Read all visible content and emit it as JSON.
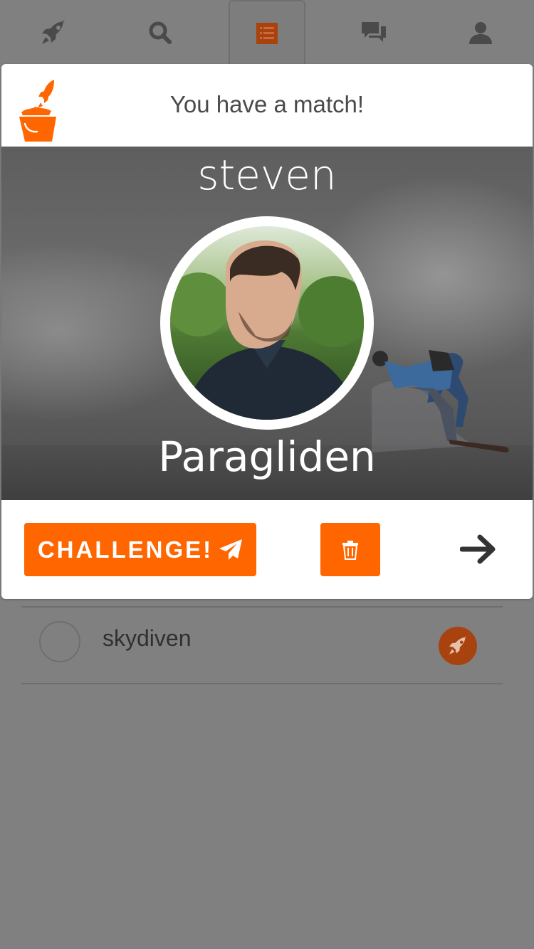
{
  "colors": {
    "accent": "#ff6600",
    "overlay_bg": "#808080",
    "text_dark": "#4a4a4a"
  },
  "tabbar": {
    "tabs": [
      {
        "icon": "rocket-icon"
      },
      {
        "icon": "search-icon"
      },
      {
        "icon": "list-icon",
        "active": true
      },
      {
        "icon": "chat-icon"
      },
      {
        "icon": "user-icon"
      }
    ]
  },
  "list": {
    "items": [
      {
        "name": "skydiven",
        "badge_icon": "rocket-icon"
      }
    ]
  },
  "modal": {
    "title": "You have a match!",
    "logo_icon": "bucket-rocket-logo",
    "match": {
      "name": "steven",
      "activity": "Paragliden"
    },
    "challenge_label": "CHALLENGE!",
    "challenge_icon": "paper-plane-icon",
    "delete_icon": "trash-icon",
    "next_icon": "arrow-right-icon"
  }
}
